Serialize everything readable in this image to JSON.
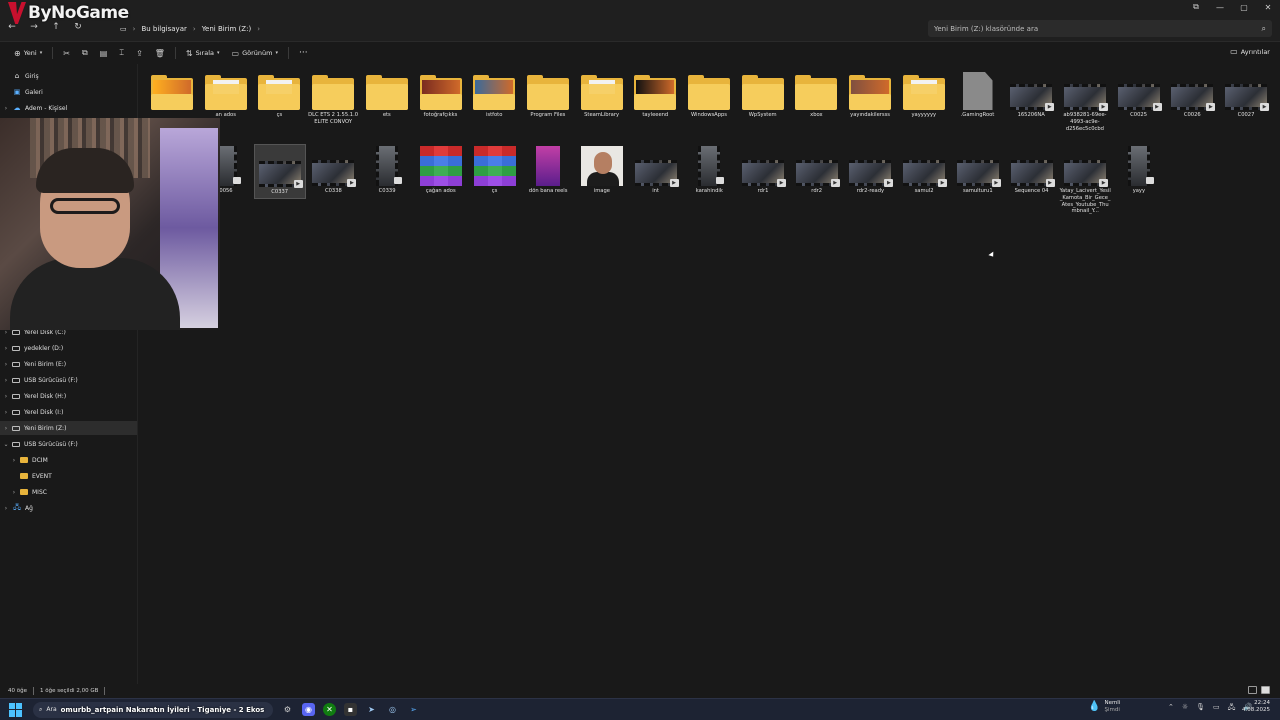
{
  "logo": {
    "text": "ByNoGame"
  },
  "window": {
    "min": "—",
    "max": "▢",
    "close": "✕",
    "restore": "⧉"
  },
  "address": {
    "crumbs": [
      "Bu bilgisayar",
      "Yeni Birim (Z:)"
    ],
    "search_placeholder": "Yeni Birim (Z:) klasöründe ara"
  },
  "toolbar": {
    "new_label": "Yeni",
    "sort_label": "Sırala",
    "view_label": "Görünüm",
    "more_label": "···",
    "details_label": "Ayrıntılar"
  },
  "sidebar": {
    "top": [
      {
        "label": "Giriş",
        "icon": "home-icon"
      },
      {
        "label": "Galeri",
        "icon": "gallery-icon"
      },
      {
        "label": "Adem - Kişisel",
        "icon": "cloud-icon"
      }
    ],
    "drives": [
      {
        "label": "Yerel Disk (C:)"
      },
      {
        "label": "yedekler (D:)"
      },
      {
        "label": "Yeni Birim (E:)"
      },
      {
        "label": "USB Sürücüsü (F:)"
      },
      {
        "label": "Yerel Disk (H:)"
      },
      {
        "label": "Yerel Disk (I:)"
      },
      {
        "label": "Yeni Birim (Z:)"
      }
    ],
    "usb": {
      "label": "USB Sürücüsü (F:)"
    },
    "usb_children": [
      {
        "label": "DCIM"
      },
      {
        "label": "EVENT"
      },
      {
        "label": "MISC"
      }
    ],
    "network": {
      "label": "Ağ"
    }
  },
  "files_row1": [
    {
      "label": "",
      "kind": "folder-img"
    },
    {
      "label": "an ados",
      "kind": "folder-paper"
    },
    {
      "label": "çs",
      "kind": "folder-paper"
    },
    {
      "label": "DLC ETS 2 1.55.1.0 ELITE CONVOY",
      "kind": "folder"
    },
    {
      "label": "ets",
      "kind": "folder"
    },
    {
      "label": "fotoğrafçıkks",
      "kind": "folder-img2"
    },
    {
      "label": "istfoto",
      "kind": "folder-img3"
    },
    {
      "label": "Program Files",
      "kind": "folder"
    },
    {
      "label": "SteamLibrary",
      "kind": "folder-paper"
    },
    {
      "label": "tayleeend",
      "kind": "folder-img4"
    },
    {
      "label": "WindowsApps",
      "kind": "folder"
    },
    {
      "label": "WpSystem",
      "kind": "folder"
    },
    {
      "label": "xbox",
      "kind": "folder"
    },
    {
      "label": "yayındakilersss",
      "kind": "folder-img5"
    },
    {
      "label": "yayyyyyy",
      "kind": "folder-paper"
    },
    {
      "label": ".GamingRoot",
      "kind": "doc"
    },
    {
      "label": "165206NA",
      "kind": "video"
    },
    {
      "label": "ab938281-69ee-4993-ac9e-d256ec5c0cbd",
      "kind": "video"
    },
    {
      "label": "C0025",
      "kind": "video"
    },
    {
      "label": "C0026",
      "kind": "video"
    },
    {
      "label": "C0027",
      "kind": "video"
    }
  ],
  "files_row2": [
    {
      "label": "0056",
      "kind": "portrait"
    },
    {
      "label": "C0337",
      "kind": "video",
      "selected": true
    },
    {
      "label": "C0338",
      "kind": "video"
    },
    {
      "label": "C0339",
      "kind": "portrait"
    },
    {
      "label": "çağan ados",
      "kind": "archive"
    },
    {
      "label": "çs",
      "kind": "archive"
    },
    {
      "label": "dön bana reels",
      "kind": "reel"
    },
    {
      "label": "image",
      "kind": "photo"
    },
    {
      "label": "int",
      "kind": "video"
    },
    {
      "label": "karahindik",
      "kind": "portrait"
    },
    {
      "label": "rdr1",
      "kind": "video"
    },
    {
      "label": "rdr2",
      "kind": "video"
    },
    {
      "label": "rdr2-ready",
      "kind": "video"
    },
    {
      "label": "samul2",
      "kind": "video"
    },
    {
      "label": "samulturu1",
      "kind": "video"
    },
    {
      "label": "Sequence 04",
      "kind": "video"
    },
    {
      "label": "Yatay_Lacivert_Yesil_Kamota_Bir_Gece_Ates_Youtube_Thumbnail_Y...",
      "kind": "video"
    },
    {
      "label": "yayy",
      "kind": "portrait"
    }
  ],
  "status": {
    "count": "40 öğe",
    "selected": "1 öğe seçildi  2,00 GB"
  },
  "taskbar": {
    "search_label": "Ara",
    "title_text": "omurbb_artpain Nakaratın İyileri - Tiganiye - 2 Ekos",
    "weather_title": "Nemli",
    "weather_sub": "Şimdi",
    "time": "22:24",
    "date": "4.08.2025"
  },
  "colors": {
    "folder": "#e8b43c",
    "accent": "#4cc2ff",
    "background": "#191919"
  }
}
